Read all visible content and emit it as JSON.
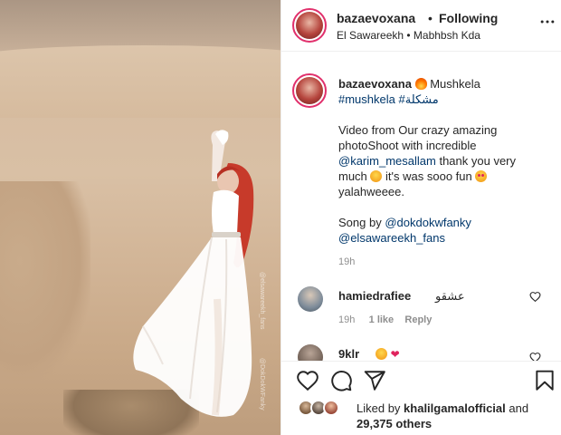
{
  "post": {
    "author": "bazaevoxana",
    "separator": "•",
    "follow_status": "Following",
    "location": "El Sawareekh • Mabhbsh Kda"
  },
  "media": {
    "watermark_1": "@elsawareekh_fans",
    "watermark_2": "@DokDokWFanky"
  },
  "caption": {
    "author": "bazaevoxana",
    "title_word": "Mushkela",
    "hashtags": "#mushkela #مشكلة",
    "body_1": "Video from Our crazy amazing photoShoot with incredible",
    "mention_1": "@karim_mesallam",
    "body_2": "thank you very much",
    "body_3": "it's was sooo fun",
    "body_4": "yalahweeee.",
    "song_label": "Song by",
    "mention_2": "@dokdokwfanky",
    "mention_3": "@elsawareekh_fans",
    "time": "19h"
  },
  "comments": [
    {
      "user": "hamiedrafiee",
      "text": "عشقو",
      "time": "19h",
      "likes": "1 like",
      "reply_label": "Reply"
    },
    {
      "user": "9klr",
      "text": ""
    }
  ],
  "likes": {
    "prefix": "Liked by",
    "user": "khalilgamalofficial",
    "conj": "and",
    "count": "29,375 others"
  },
  "icons": {
    "more": "more-horizontal-icon",
    "like": "heart-outline-icon",
    "comment": "comment-bubble-icon",
    "share": "paper-plane-icon",
    "save": "bookmark-icon",
    "comment_like": "small-heart-icon"
  },
  "colors": {
    "link": "#00376b",
    "muted": "#8e8e8e",
    "text": "#262626",
    "story_ring": "#e1306c",
    "border": "#efefef"
  }
}
